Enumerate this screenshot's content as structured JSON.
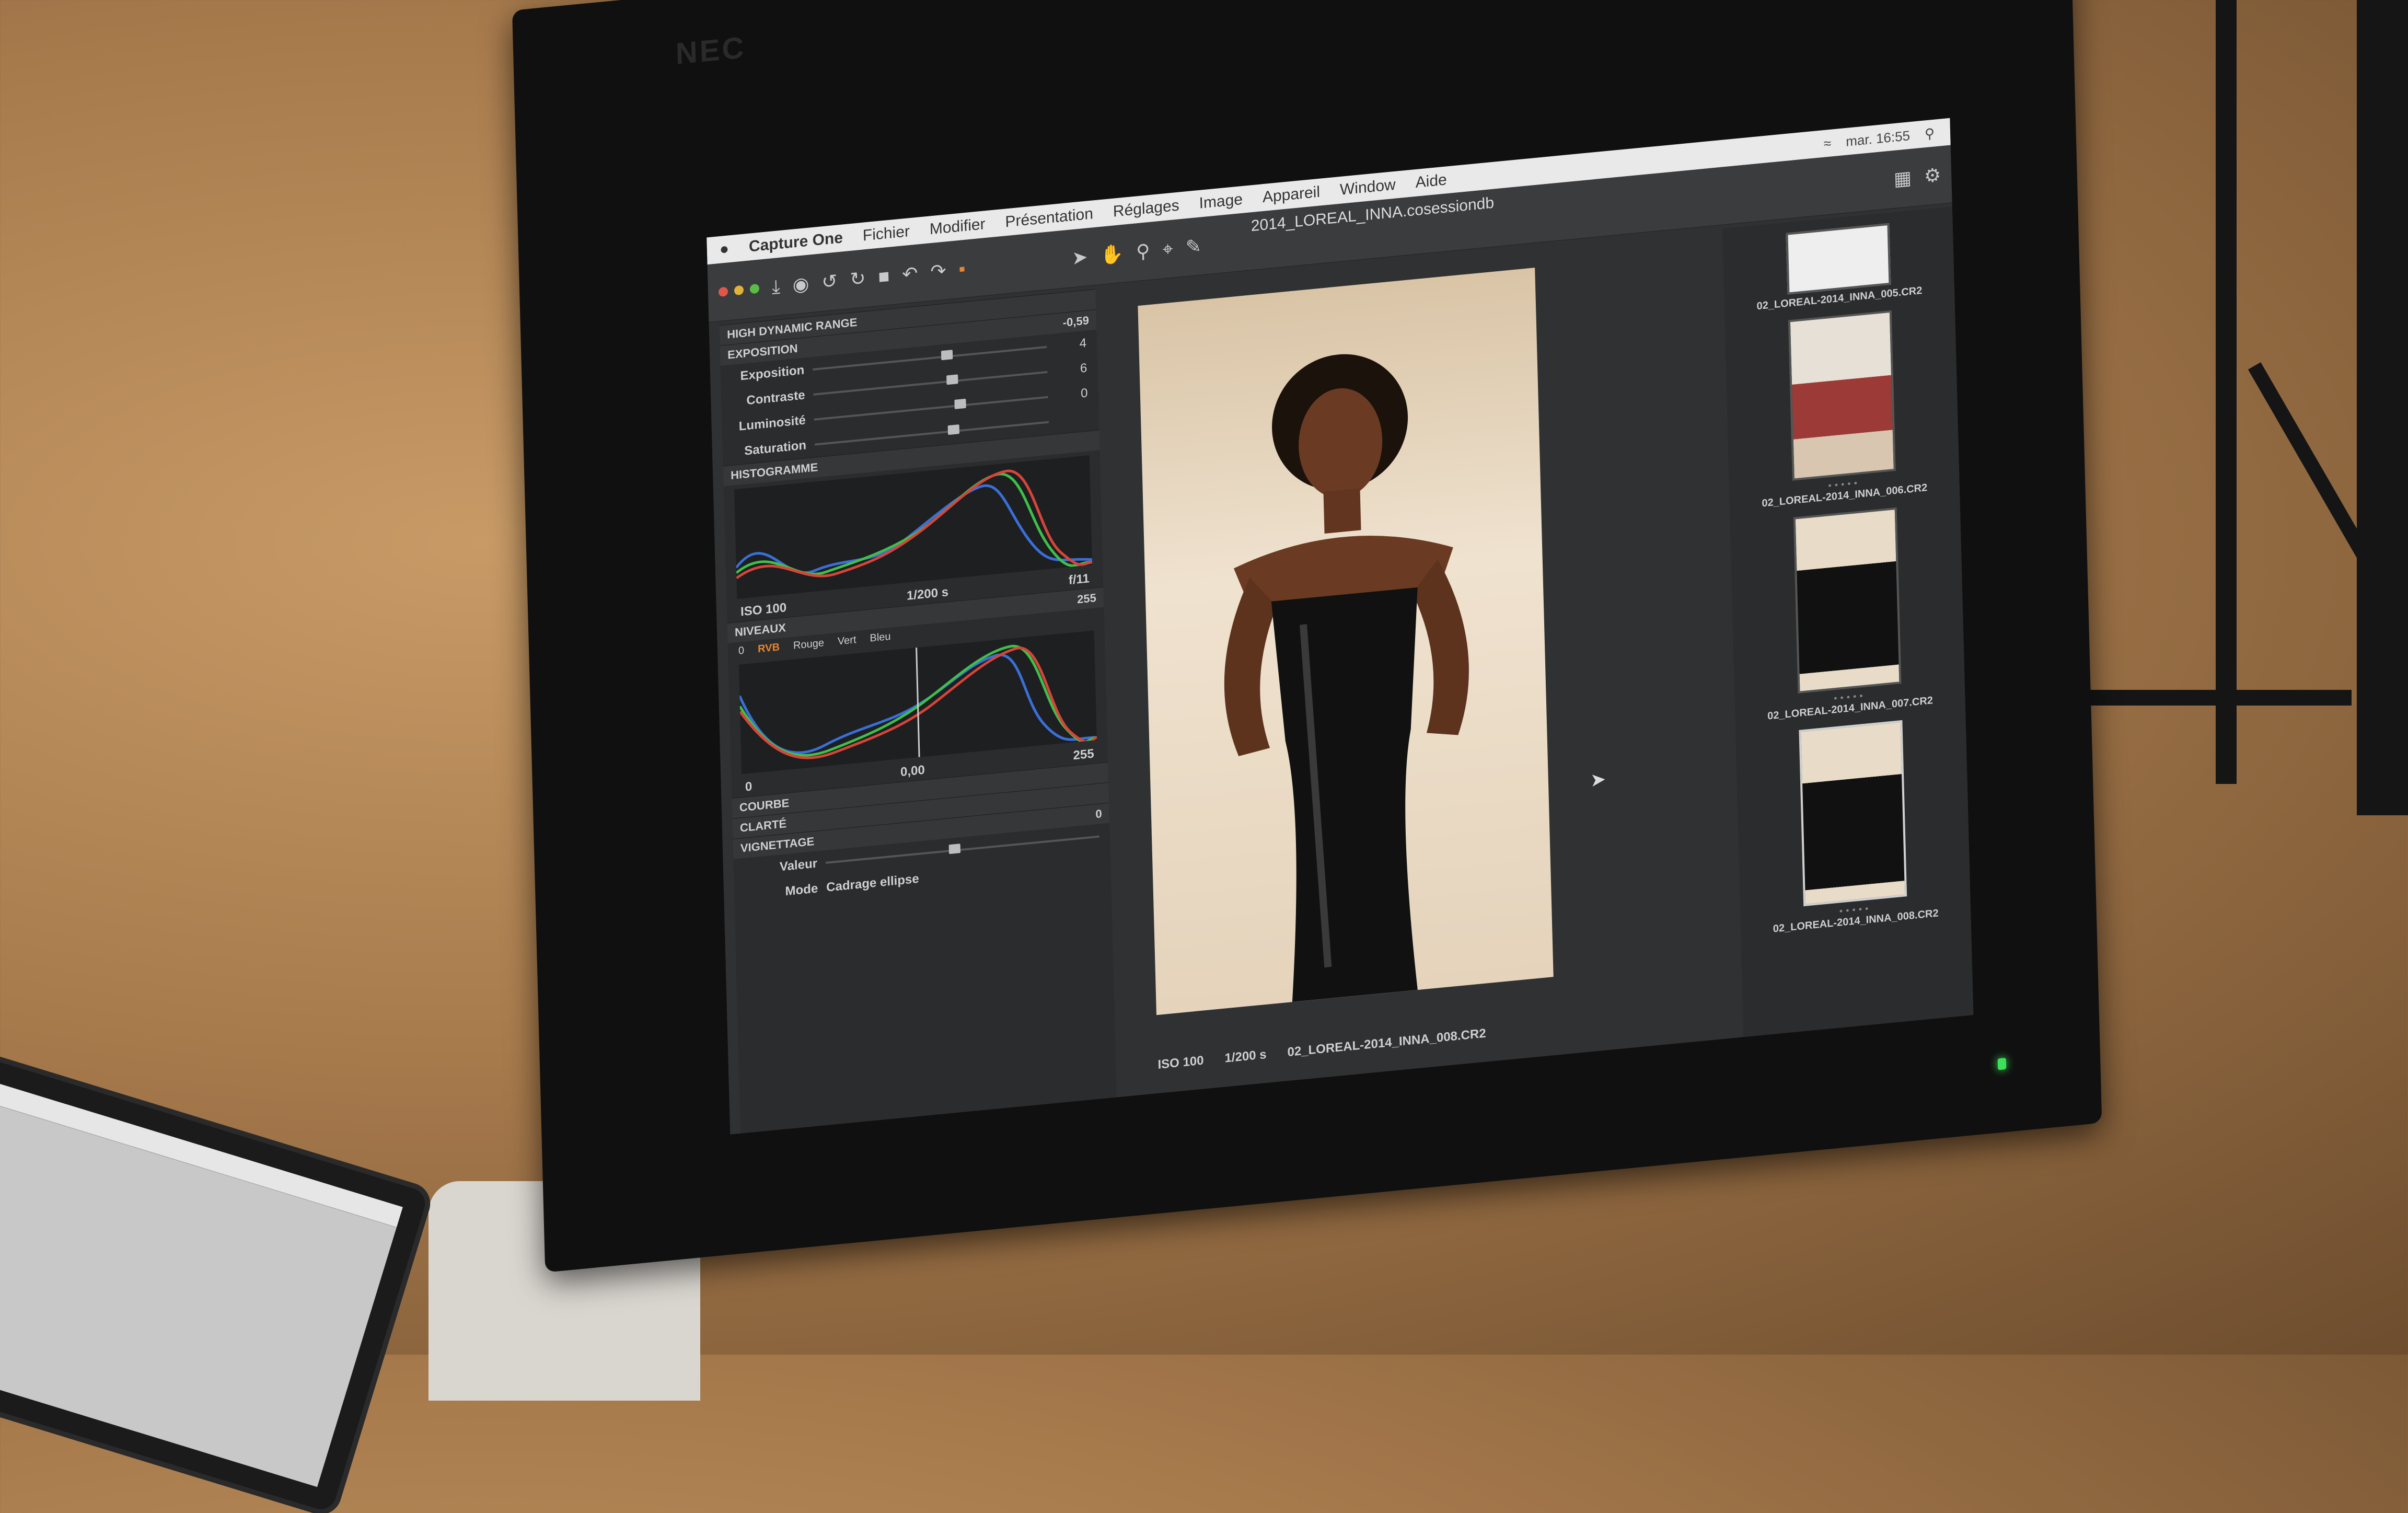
{
  "monitor": {
    "brand": "NEC"
  },
  "menubar": {
    "app": "Capture One",
    "items": [
      "Fichier",
      "Modifier",
      "Présentation",
      "Réglages",
      "Image",
      "Appareil",
      "Window",
      "Aide"
    ],
    "clock": "mar. 16:55"
  },
  "document": {
    "title": "2014_LOREAL_INNA.cosessiondb"
  },
  "left_panel": {
    "hdr_section": "HIGH DYNAMIC RANGE",
    "exposure_section": "EXPOSITION",
    "exposure_value": "-0,59",
    "sliders": [
      {
        "label": "Exposition",
        "value": "4",
        "level": 0.55
      },
      {
        "label": "Contraste",
        "value": "6",
        "level": 0.57
      },
      {
        "label": "Luminosité",
        "value": "0",
        "level": 0.6
      },
      {
        "label": "Saturation",
        "value": "",
        "level": 0.57
      }
    ],
    "histogram_section": "HISTOGRAMME",
    "histogram_meta": {
      "iso": "ISO 100",
      "shutter": "1/200 s",
      "aperture": "f/11"
    },
    "levels_section": "NIVEAUX",
    "levels_max": "255",
    "levels_min": "0",
    "levels_tabs": [
      "RVB",
      "Rouge",
      "Vert",
      "Bleu"
    ],
    "levels_mid": "0,00",
    "levels_out_max": "255",
    "levels_out_min": "0",
    "curve_section": "COURBE",
    "clarity_section": "CLARTÉ",
    "vignette_section": "VIGNETTAGE",
    "vignette_value": "0",
    "vignette_rows": [
      {
        "label": "Valeur",
        "value": ""
      },
      {
        "label": "Mode",
        "value": "Cadrage ellipse"
      }
    ]
  },
  "viewer": {
    "caption_iso": "ISO 100",
    "caption_shutter": "1/200 s",
    "caption_file": "02_LOREAL-2014_INNA_008.CR2"
  },
  "filmstrip": [
    {
      "file": "02_LOREAL-2014_INNA_005.CR2",
      "selected": false
    },
    {
      "file": "02_LOREAL-2014_INNA_006.CR2",
      "selected": false
    },
    {
      "file": "02_LOREAL-2014_INNA_007.CR2",
      "selected": false
    },
    {
      "file": "02_LOREAL-2014_INNA_008.CR2",
      "selected": true
    }
  ],
  "colors": {
    "accent": "#e7862c",
    "panel": "#2a2c2e",
    "menubar": "#e9e9ea"
  }
}
